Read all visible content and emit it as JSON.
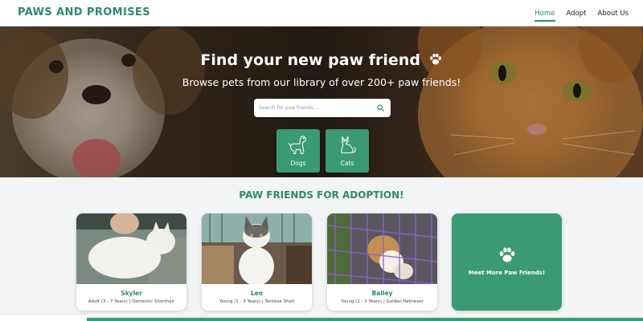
{
  "brand": {
    "logo_text": "PAWS AND PROMISES",
    "color": "#2e8b66"
  },
  "nav": {
    "links": [
      {
        "label": "Home",
        "active": true
      },
      {
        "label": "Adopt",
        "active": false
      },
      {
        "label": "About Us",
        "active": false
      }
    ]
  },
  "hero": {
    "title": "Find your new paw friend",
    "subtitle": "Browse pets from our library of over 200+ paw friends!",
    "search": {
      "placeholder": "Search for paw friends...",
      "value": ""
    },
    "categories": [
      {
        "label": "Dogs",
        "icon": "dog-icon"
      },
      {
        "label": "Cats",
        "icon": "cat-icon"
      }
    ]
  },
  "adoption": {
    "section_title": "PAW FRIENDS FOR ADOPTION!",
    "pets": [
      {
        "name": "Skyler",
        "meta": "Adult (3 - 7 Years) | Domestic Shorthair"
      },
      {
        "name": "Leo",
        "meta": "Young (1 - 3 Years) | Tortoise Shell"
      },
      {
        "name": "Bailey",
        "meta": "Young (1 - 3 Years) | Golden Retriever"
      }
    ],
    "more_label": "Meet More Paw Friends!"
  },
  "colors": {
    "accent": "#3a9a74",
    "background": "#f2f4f5"
  }
}
